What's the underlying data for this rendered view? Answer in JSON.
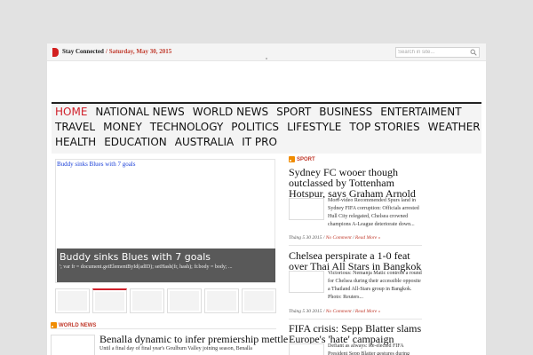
{
  "topbar": {
    "stay_connected": "Stay Connected",
    "date": "/ Saturday, May 30, 2015",
    "search_placeholder": "Search in site..."
  },
  "nav": {
    "row1": [
      "HOME",
      "NATIONAL NEWS",
      "WORLD NEWS",
      "SPORT",
      "BUSINESS",
      "ENTERTAIMENT"
    ],
    "row2": [
      "TRAVEL",
      "MONEY",
      "TECHNOLOGY",
      "POLITICS",
      "LIFESTYLE",
      "TOP STORIES",
      "WEATHER"
    ],
    "row3": [
      "HEALTH",
      "EDUCATION",
      "AUSTRALIA",
      "IT PRO"
    ]
  },
  "slider": {
    "small_title": "Buddy sinks Blues with 7 goals",
    "caption_title": "Buddy sinks Blues with 7 goals",
    "caption_text": "'; var fr = document.getElementById(adID); setHash(fr, hash); fr.body = body; ..."
  },
  "world_news": {
    "label": "WORLD NEWS",
    "title": "Benalla dynamic to infer premiership mettle",
    "excerpt": "Until a final day of final year's Goulburn Valley joining season, Benalla"
  },
  "sport": {
    "label": "SPORT",
    "posts": [
      {
        "title": "Sydney FC wooer though outclassed by Tottenham Hotspur, says Graham Arnold",
        "excerpt": "More-video Recommended Spurs land in Sydney FIFA corruption: Officials arrested Hull City relegated, Chelsea crowned champions A-League deteriorate down...",
        "date": "Tháng 5 30 2015",
        "comments": "No Comment",
        "read_more": "Read More »"
      },
      {
        "title": "Chelsea perspirate a 1-0 feat over Thai All Stars in Bangkok",
        "excerpt": "Victorious: Nemanja Matic controls a round for Chelsea during their accessible opposite a Thailand All-Stars group in Bangkok. Photo: Reuters...",
        "date": "Tháng 5 30 2015",
        "comments": "No Comment",
        "read_more": "Read More »"
      },
      {
        "title": "FIFA crisis: Sepp Blatter slams Europe's 'hate' campaign",
        "excerpt": "Defiant as always: Re-elected FIFA President Sepp Blatter gestures during",
        "date": "",
        "comments": "",
        "read_more": ""
      }
    ]
  },
  "colors": {
    "accent_red": "#d0202a",
    "feed_orange": "#f08c00",
    "link_blue": "#1a3fd8"
  }
}
